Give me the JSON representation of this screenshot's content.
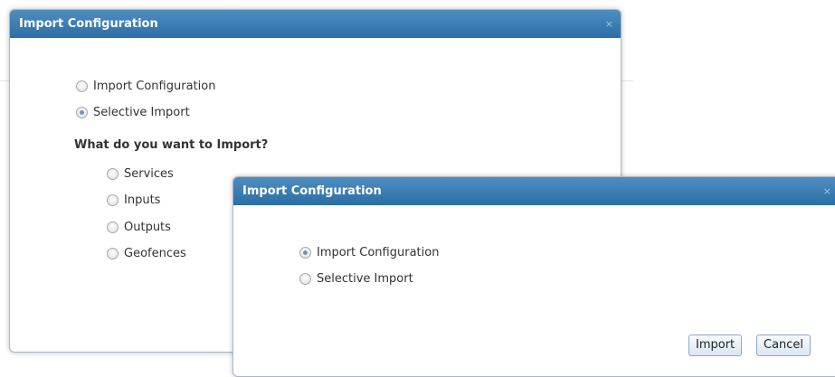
{
  "dialog_back": {
    "title": "Import Configuration",
    "close_label": "×",
    "options": [
      {
        "label": "Import Configuration",
        "checked": false
      },
      {
        "label": "Selective Import",
        "checked": true
      }
    ],
    "question": "What do you want to Import?",
    "sub_options": [
      {
        "label": "Services",
        "checked": false
      },
      {
        "label": "Inputs",
        "checked": false
      },
      {
        "label": "Outputs",
        "checked": false
      },
      {
        "label": "Geofences",
        "checked": false
      }
    ]
  },
  "dialog_front": {
    "title": "Import Configuration",
    "close_label": "×",
    "options": [
      {
        "label": "Import Configuration",
        "checked": true
      },
      {
        "label": "Selective Import",
        "checked": false
      }
    ],
    "buttons": {
      "import_label": "Import",
      "cancel_label": "Cancel"
    }
  },
  "colors": {
    "titlebar": "#3a7db4",
    "radio_selected": "#6f95b8"
  }
}
